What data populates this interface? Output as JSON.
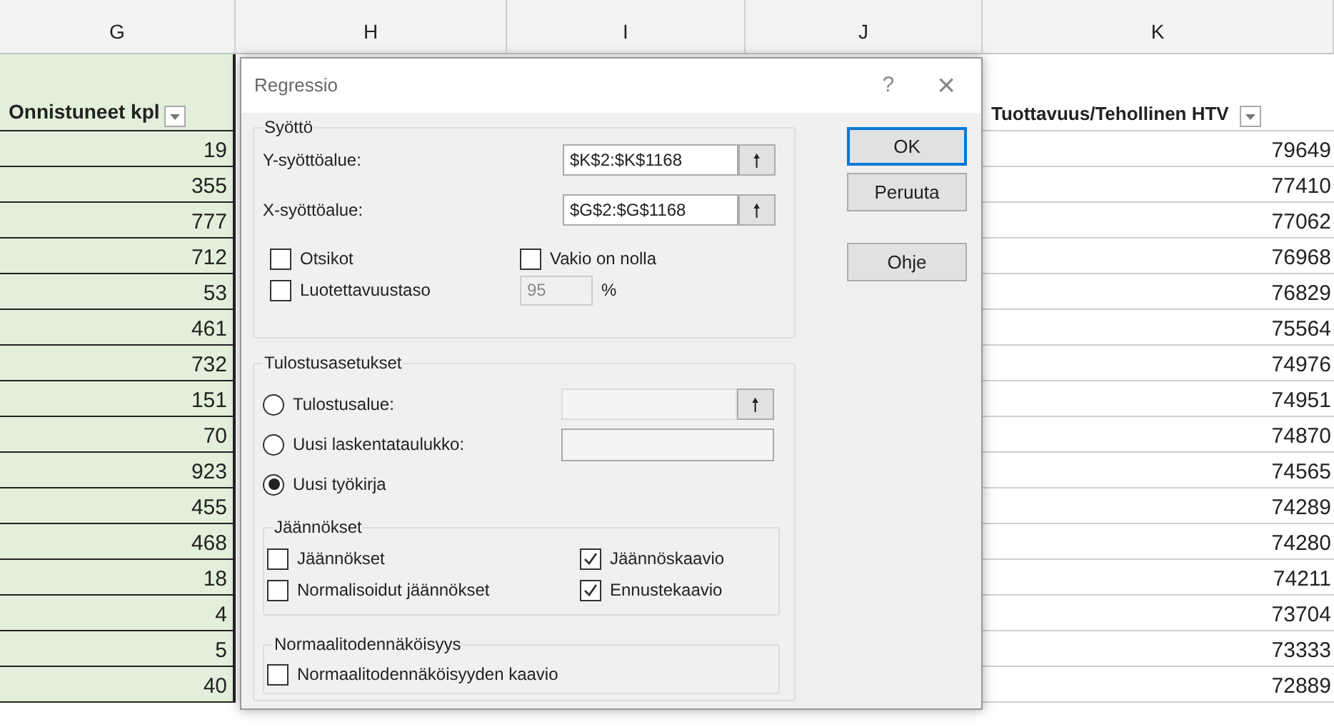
{
  "sheet": {
    "column_letters": [
      "G",
      "H",
      "I",
      "J",
      "K"
    ],
    "header_g": "Onnistuneet kpl",
    "header_k": "Tuottavuus/Tehollinen HTV",
    "rows": [
      {
        "g": "19",
        "k": "79649"
      },
      {
        "g": "355",
        "k": "77410"
      },
      {
        "g": "777",
        "k": "77062"
      },
      {
        "g": "712",
        "k": "76968"
      },
      {
        "g": "53",
        "k": "76829"
      },
      {
        "g": "461",
        "k": "75564"
      },
      {
        "g": "732",
        "k": "74976"
      },
      {
        "g": "151",
        "k": "74951"
      },
      {
        "g": "70",
        "k": "74870"
      },
      {
        "g": "923",
        "k": "74565"
      },
      {
        "g": "455",
        "k": "74289"
      },
      {
        "g": "468",
        "k": "74280"
      },
      {
        "g": "18",
        "k": "74211"
      },
      {
        "g": "4",
        "k": "73704"
      },
      {
        "g": "5",
        "k": "73333"
      },
      {
        "g": "40",
        "k": "72889"
      }
    ]
  },
  "dialog": {
    "title": "Regressio",
    "help": "?",
    "close": "×",
    "input": {
      "title": "Syöttö",
      "ranges": [
        {
          "label": "Y-syöttöalue:",
          "value": "$K$2:$K$1168",
          "button": "🠕"
        },
        {
          "label": "X-syöttöalue:",
          "value": "$G$2:$G$1168",
          "button": "🠕"
        }
      ],
      "headers": {
        "label": "Otsikot",
        "checked": false
      },
      "constant_zero": {
        "label": "Vakio on nolla",
        "checked": false
      },
      "confidence": {
        "label": "Luotettavuustaso",
        "checked": false,
        "value": "95",
        "disabled": true,
        "unit": "%"
      }
    },
    "output": {
      "title": "Tulostusasetukset",
      "options": [
        {
          "label": "Tulostusalue:",
          "selected": false,
          "kind": "range"
        },
        {
          "label": "Uusi laskentataulukko:",
          "selected": false,
          "kind": "text"
        },
        {
          "label": "Uusi työkirja",
          "selected": true,
          "kind": "plain"
        }
      ],
      "range_button": "🠕",
      "residuals": {
        "title": "Jäännökset",
        "items": [
          {
            "label": "Jäännökset",
            "checked": false
          },
          {
            "label": "Jäännöskaavio",
            "checked": true
          },
          {
            "label": "Normalisoidut jäännökset",
            "checked": false
          },
          {
            "label": "Ennustekaavio",
            "checked": true
          }
        ]
      },
      "normal": {
        "title": "Normaalitodennäköisyys",
        "items": [
          {
            "label": "Normaalitodennäköisyyden kaavio",
            "checked": false
          }
        ]
      }
    },
    "buttons": [
      {
        "label": "OK",
        "default": true
      },
      {
        "label": "Peruuta",
        "default": false
      },
      {
        "label": "Ohje",
        "default": false
      }
    ]
  }
}
